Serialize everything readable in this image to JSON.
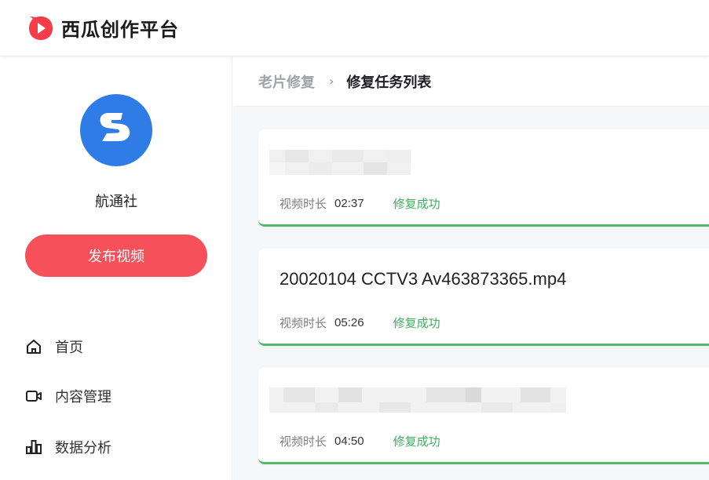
{
  "header": {
    "app_name": "西瓜创作平台",
    "logo_icon": "watermelon-play-logo-icon",
    "brand_color": "#f53c49"
  },
  "sidebar": {
    "username": "航通社",
    "avatar_color": "#2f7ce6",
    "publish_label": "发布视频",
    "publish_color": "#f6515b",
    "nav": [
      {
        "label": "首页",
        "icon": "home-icon"
      },
      {
        "label": "内容管理",
        "icon": "video-camera-icon"
      },
      {
        "label": "数据分析",
        "icon": "bar-chart-icon"
      }
    ]
  },
  "breadcrumb": {
    "parent": "老片修复",
    "separator": "›",
    "current": "修复任务列表"
  },
  "tasks": [
    {
      "title": "",
      "title_blurred": true,
      "duration_label": "视频时长",
      "duration": "02:37",
      "status": "修复成功"
    },
    {
      "title": "20020104 CCTV3 Av463873365.mp4",
      "title_blurred": false,
      "duration_label": "视频时长",
      "duration": "05:26",
      "status": "修复成功"
    },
    {
      "title": "",
      "title_blurred": true,
      "duration_label": "视频时长",
      "duration": "04:50",
      "status": "修复成功"
    }
  ],
  "colors": {
    "success": "#3fae5e",
    "success_border": "#52b86c"
  }
}
